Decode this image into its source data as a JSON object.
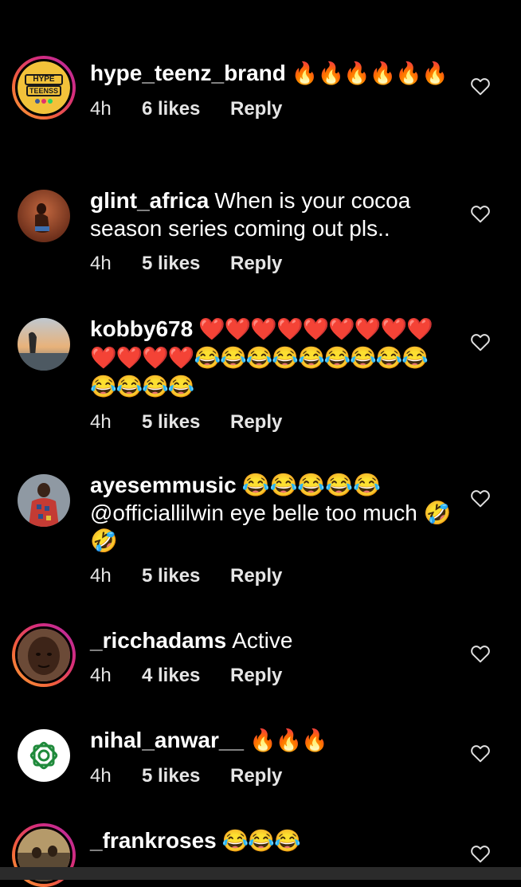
{
  "comments": [
    {
      "username": "hype_teenz_brand",
      "text": "🔥🔥🔥🔥🔥🔥",
      "time": "4h",
      "likes": "6 likes",
      "reply": "Reply",
      "avatar_text": [
        "HYPE",
        "TEENSS"
      ]
    },
    {
      "username": "glint_africa",
      "text": "When is your cocoa season series coming out pls..",
      "time": "4h",
      "likes": "5 likes",
      "reply": "Reply"
    },
    {
      "username": "kobby678",
      "text": "❤️❤️❤️❤️❤️❤️❤️❤️❤️❤️❤️❤️❤️😂😂😂😂😂😂😂😂😂😂😂😂😂",
      "time": "4h",
      "likes": "5 likes",
      "reply": "Reply"
    },
    {
      "username": "ayesemmusic",
      "text": "😂😂😂😂😂 @officiallilwin eye  belle too much 🤣🤣",
      "time": "4h",
      "likes": "5 likes",
      "reply": "Reply"
    },
    {
      "username": "_ricchadams",
      "text": "Active",
      "time": "4h",
      "likes": "4 likes",
      "reply": "Reply"
    },
    {
      "username": "nihal_anwar__",
      "text": "🔥🔥🔥",
      "time": "4h",
      "likes": "5 likes",
      "reply": "Reply"
    },
    {
      "username": "_frankroses",
      "text": "😂😂😂"
    }
  ],
  "colors": {
    "background": "#000000",
    "text": "#ffffff",
    "meta": "#e5e5e5",
    "story_ring": "#d62d7b"
  },
  "icons": {
    "like": "heart-outline-icon"
  }
}
